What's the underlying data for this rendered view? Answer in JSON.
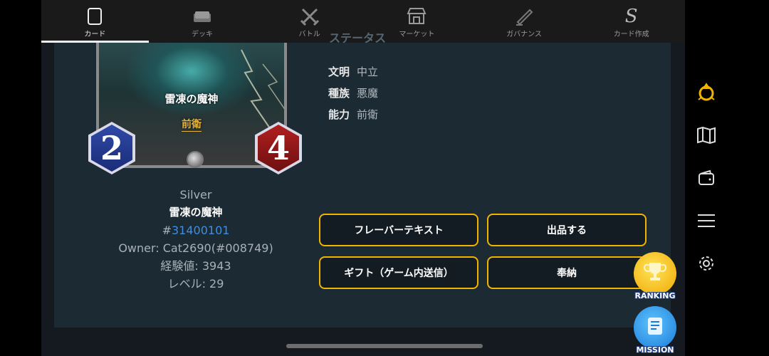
{
  "topnav": {
    "tabs": [
      {
        "label": "カード",
        "icon": "card-icon",
        "active": true
      },
      {
        "label": "デッキ",
        "icon": "deck-icon",
        "active": false
      },
      {
        "label": "バトル",
        "icon": "battle-icon",
        "active": false
      },
      {
        "label": "マーケット",
        "icon": "market-icon",
        "active": false
      },
      {
        "label": "ガバナンス",
        "icon": "governance-icon",
        "active": false
      },
      {
        "label": "カード作成",
        "icon": "card-create-icon",
        "active": false
      }
    ]
  },
  "card": {
    "name": "雷凍の魔神",
    "role": "前衛",
    "cost": "2",
    "power": "4",
    "rarity": "Silver",
    "id_prefix": "#",
    "id": "31400101",
    "owner": "Owner: Cat2690(#008749)",
    "exp": "経験値: 3943",
    "level": "レベル: 29"
  },
  "status": {
    "title": "ステータス",
    "rows": [
      {
        "label": "文明",
        "value": "中立"
      },
      {
        "label": "種族",
        "value": "悪魔"
      },
      {
        "label": "能力",
        "value": "前衛"
      }
    ]
  },
  "actions": {
    "flavor": "フレーバーテキスト",
    "sell": "出品する",
    "gift": "ギフト（ゲーム内送信）",
    "offer": "奉納"
  },
  "badges": {
    "ranking": "RANKING",
    "mission": "MISSION"
  },
  "sidebar_icons": [
    "guild-icon",
    "map-icon",
    "wallet-icon",
    "menu-icon",
    "settings-icon"
  ],
  "colors": {
    "accent": "#f0b400",
    "link": "#3f8ee0"
  }
}
